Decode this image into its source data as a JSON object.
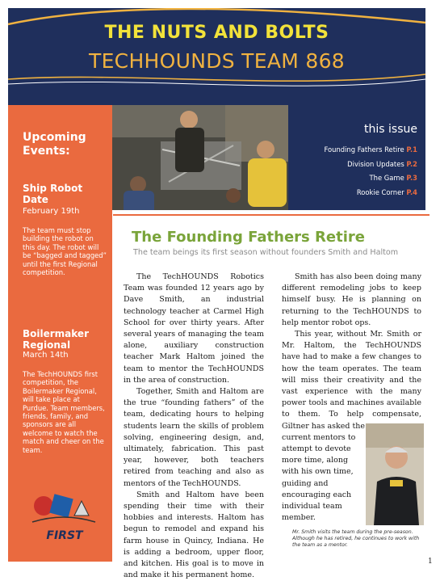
{
  "masthead": {
    "title": "THE NUTS AND BOLTS",
    "subtitle": "TECHHOUNDS TEAM 868"
  },
  "sidebar": {
    "heading": "Upcoming Events:",
    "events": [
      {
        "name": "Ship Robot Date",
        "date": "February 19th",
        "body": "The team must stop building the robot on this day. The robot will be “bagged and tagged” until the first Regional competition."
      },
      {
        "name": "Boilermaker Regional",
        "date": "March 14th",
        "body": "The TechHOUNDS first competition, the Boilermaker Regional, will take place at Purdue. Team members, friends, family, and sponsors are all welcome to watch the match and cheer on the team."
      }
    ],
    "logo_text": "FIRST"
  },
  "issue": {
    "title": "this issue",
    "items": [
      {
        "label": "Founding Fathers Retire",
        "page": "P.1"
      },
      {
        "label": "Division Updates",
        "page": "P.2"
      },
      {
        "label": "The Game",
        "page": "P.3"
      },
      {
        "label": "Rookie Corner",
        "page": "P.4"
      }
    ]
  },
  "article": {
    "headline": "The Founding Fathers Retire",
    "subhead": "The team beings its first season without founders Smith and Haltom",
    "col1": [
      "The TechHOUNDS Robotics Team was founded 12 years ago by Dave Smith, an industrial technology teacher at Carmel High School for over thirty years. After several years of managing the team alone, auxiliary construction teacher Mark Haltom joined the team to mentor the TechHOUNDS in the area of construction.",
      "Together, Smith and Haltom are the true “founding fathers” of the team, dedicating hours to helping students learn the skills of problem solving, engineering design, and, ultimately, fabrication. This past year, however, both teachers retired from teaching and also as mentors of the TechHOUNDS.",
      "Smith and Haltom have been spending their time with their hobbies and interests. Haltom has begun to remodel and expand his farm house in Quincy, Indiana. He is adding a bedroom, upper floor, and kitchen. His goal is to move in and make it his permanent home."
    ],
    "col2_p1": "Smith has also been doing many different remodeling jobs to keep himself busy. He is planning on returning to the TechHOUNDS to help mentor robot ops.",
    "col2_p2_full": "This year, without Mr. Smith or Mr. Haltom, the TechHOUNDS have had to make a few changes to how the team operates. The team will miss their creativity and the vast experience with the many power tools and machines available to them. To help compensate, Giltner has asked the",
    "col2_p2_wrap": "current mentors to attempt to devote more time, along with his own time, guiding and encouraging each individual team member.",
    "caption": "Mr. Smith visits the team during the pre-season. Although he has retired, he continues to work with the team as a mentor."
  },
  "page_number": "1",
  "colors": {
    "navy": "#1f2f5c",
    "orange": "#ea6a3f",
    "yellow": "#f2e23a",
    "gold": "#f0b240",
    "green": "#7aa43a"
  }
}
